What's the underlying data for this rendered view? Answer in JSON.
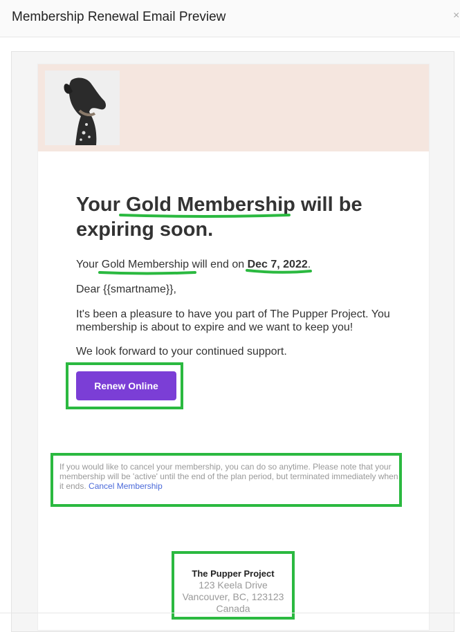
{
  "window": {
    "title": "Membership Renewal Email Preview",
    "close_glyph": "×"
  },
  "email": {
    "hero_image": "dog-photo",
    "headline": {
      "prefix": "Your ",
      "membership": "Gold Membership",
      "suffix": " will be expiring soon."
    },
    "end_line": {
      "prefix": "Your ",
      "membership": "Gold Membership",
      "middle": " will end on ",
      "date": "Dec 7, 2022",
      "suffix": "."
    },
    "greeting": "Dear {{smartname}},",
    "body": "It's been a pleasure to have you part of The Pupper Project. You membership is about to expire and we want to keep you!",
    "support": "We look forward to your continued support.",
    "renew_label": "Renew Online",
    "cancel_text": "If you would like to cancel your membership, you can do so anytime. Please note that your membership will be 'active' until the end of the plan period, but terminated immediately when it ends.",
    "cancel_link": "Cancel Membership",
    "footer": {
      "org": "The Pupper Project",
      "street": "123 Keela Drive",
      "city": "Vancouver, BC, 123123",
      "country": "Canada"
    }
  },
  "colors": {
    "accent": "#7b3ed6",
    "hero_bg": "#f5e6df",
    "highlight": "#2bb940",
    "link": "#4a69d9"
  }
}
